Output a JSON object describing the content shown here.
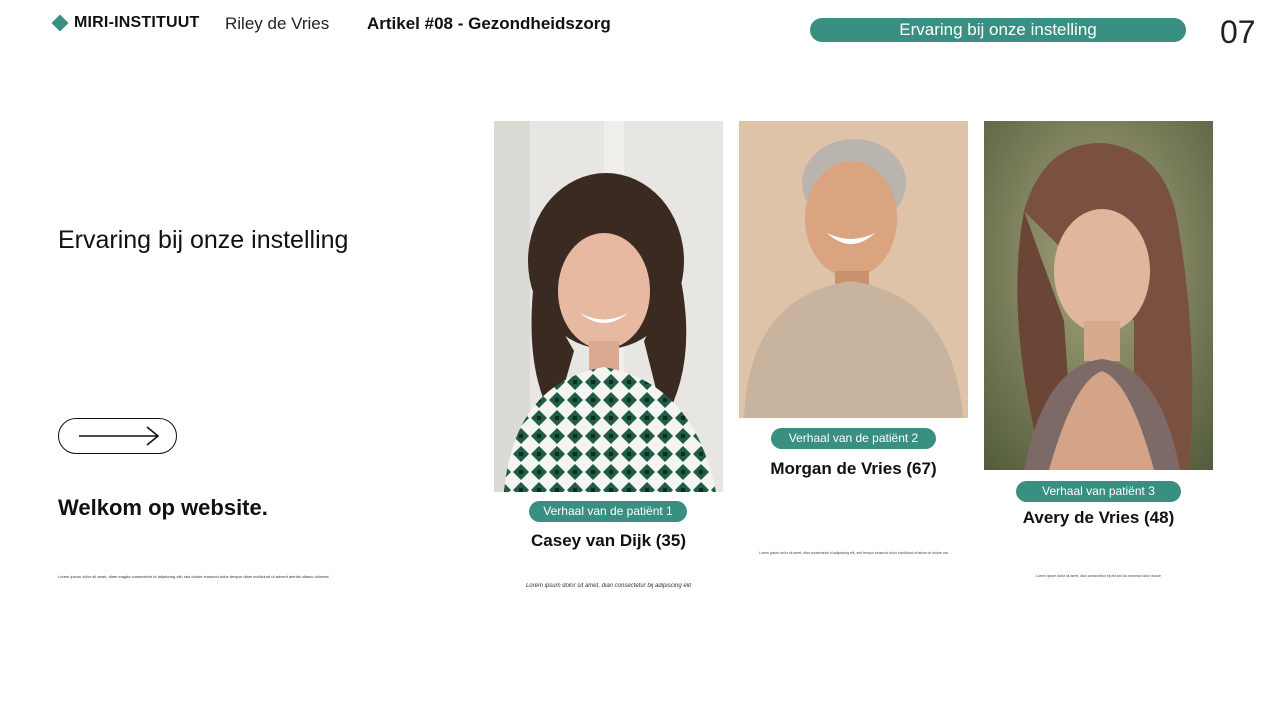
{
  "header": {
    "brand": "MIRI-INSTITUUT",
    "author": "Riley de Vries",
    "article": "Artikel #08 - Gezondheidszorg",
    "pill": "Ervaring bij onze instelling",
    "page_number": "07"
  },
  "left": {
    "title": "Ervaring bij onze instelling",
    "welcome": "Welkom op website.",
    "body": "Lorem ipsum dolor sit amet, diam magda consectetur id adipiscing elit, sed dolore eiusmod dolor tempor diam incididunt ut adverd alentis ullamc dolorest"
  },
  "cards": [
    {
      "badge": "Verhaal van de patiënt 1",
      "name": "Casey van Dijk (35)",
      "caption": "Lorem ipsum dolor sit amet, dian consectetur bij adipiscing elit"
    },
    {
      "badge": "Verhaal van de patiënt 2",
      "name": "Morgan de Vries (67)",
      "caption": "Lorem ipsum dolor sit amet, dian consectetur id adipiscing elit, sed tempor eiusmod dolor incididunt ut labore et dolore magna aliqua"
    },
    {
      "badge": "Verhaal van patiënt 3",
      "name": "Avery de Vries (48)",
      "caption": "Lorem ipsum dolor sit amet, dian consectetur bij elit sed do eiusmod dolor dolore"
    }
  ],
  "colors": {
    "accent": "#3a8f83",
    "text": "#111111",
    "background": "#ffffff"
  },
  "icons": [
    "diamond-icon",
    "arrow-right-icon"
  ]
}
